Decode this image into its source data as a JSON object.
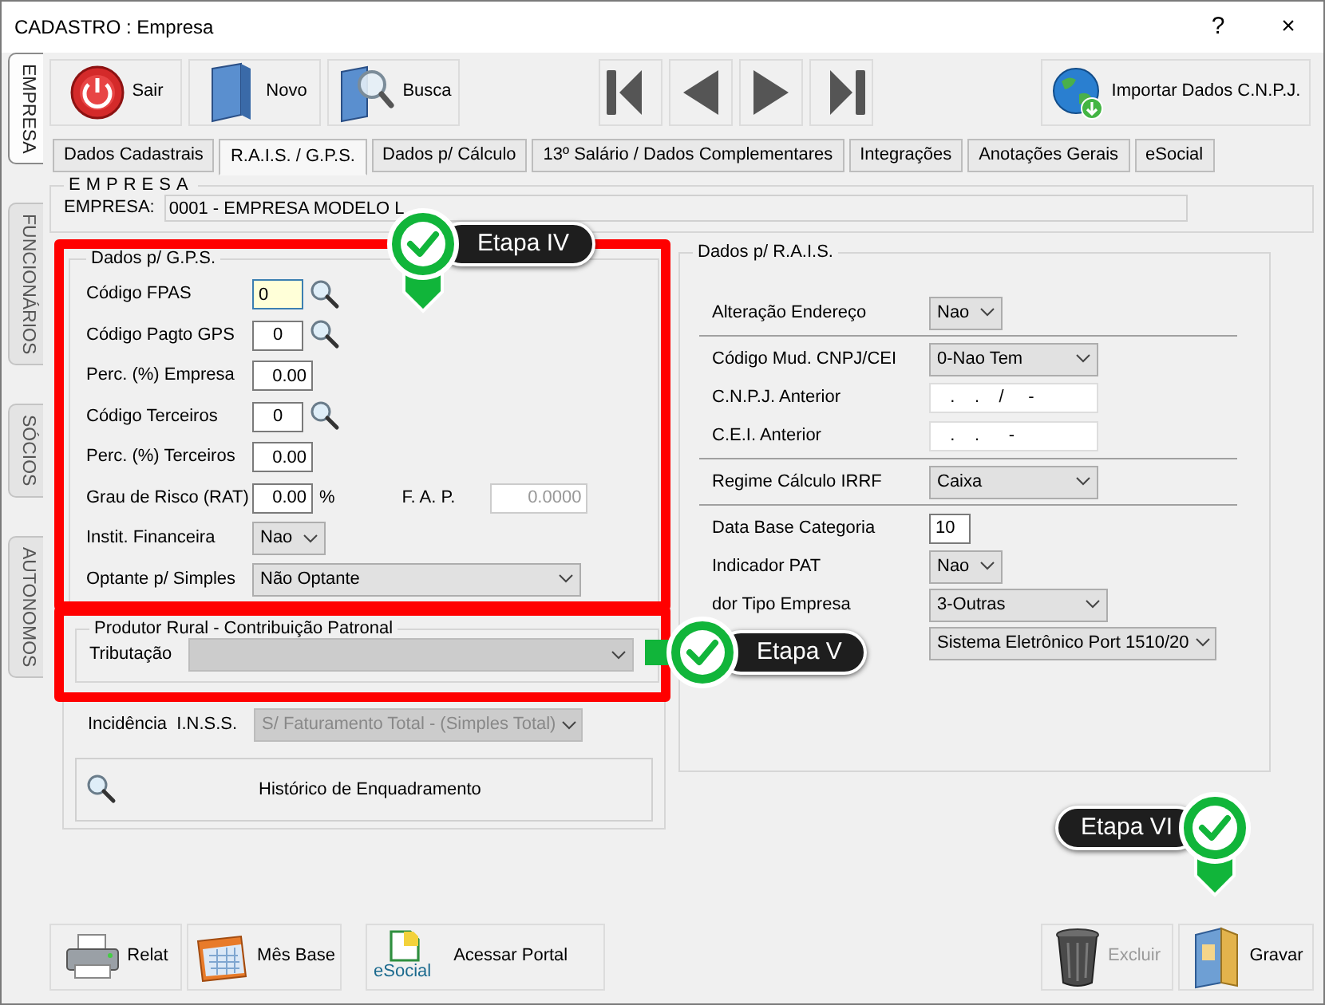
{
  "window": {
    "title": "CADASTRO : Empresa",
    "help": "?",
    "close": "×"
  },
  "side_tabs": [
    {
      "label": "EMPRESA",
      "selected": true
    },
    {
      "label": "FUNCIONÁRIOS",
      "selected": false
    },
    {
      "label": "SÓCIOS",
      "selected": false
    },
    {
      "label": "AUTONOMOS",
      "selected": false
    }
  ],
  "toolbar": [
    {
      "kind": "power",
      "label": "Sair"
    },
    {
      "kind": "book",
      "label": "Novo"
    },
    {
      "kind": "search",
      "label": "Busca"
    }
  ],
  "nav_buttons": [
    {
      "kind": "first"
    },
    {
      "kind": "prev"
    },
    {
      "kind": "next"
    },
    {
      "kind": "last"
    }
  ],
  "import_button": {
    "label": "Importar Dados C.N.P.J."
  },
  "tabs": [
    {
      "label": "Dados Cadastrais",
      "selected": false
    },
    {
      "label": "R.A.I.S. / G.P.S.",
      "selected": true
    },
    {
      "label": "Dados p/ Cálculo",
      "selected": false
    },
    {
      "label": "13º Salário / Dados Complementares",
      "selected": false
    },
    {
      "label": "Integrações",
      "selected": false
    },
    {
      "label": "Anotações Gerais",
      "selected": false
    },
    {
      "label": "eSocial",
      "selected": false
    }
  ],
  "empresa": {
    "legend": "EMPRESA",
    "label": "EMPRESA:",
    "value": "0001 - EMPRESA MODELO L"
  },
  "gps": {
    "legend": "Dados p/ G.P.S.",
    "fields": [
      {
        "kind": "code",
        "label": "Código FPAS",
        "value": "0",
        "lookup": true,
        "focused": true
      },
      {
        "kind": "code",
        "label": "Código Pagto GPS",
        "value": "0",
        "lookup": true,
        "focused": false
      },
      {
        "kind": "number",
        "label": "Perc. (%) Empresa",
        "value": "0.00",
        "lookup": false,
        "focused": false
      },
      {
        "kind": "code",
        "label": "Código Terceiros",
        "value": "0",
        "lookup": true,
        "focused": false
      },
      {
        "kind": "number",
        "label": "Perc. (%) Terceiros",
        "value": "0.00",
        "lookup": false,
        "focused": false
      },
      {
        "kind": "rat",
        "label": "Grau de Risco (RAT)",
        "value": "0.00",
        "suffix": "%",
        "extra_label": "F. A. P.",
        "extra_value": "0.0000",
        "lookup": false,
        "focused": false
      },
      {
        "kind": "small-select",
        "label": "Instit. Financeira",
        "value": "Nao"
      },
      {
        "kind": "wide-select",
        "label": "Optante p/ Simples",
        "value": "Não Optante"
      }
    ]
  },
  "produtor": {
    "legend": "Produtor Rural - Contribuição Patronal",
    "label": "Tributação",
    "disabled": true
  },
  "incidencia": {
    "label": "Incidência  I.N.S.S.",
    "value": "S/ Faturamento Total - (Simples Total)",
    "disabled": true
  },
  "historico_button": {
    "label": "Histórico de Enquadramento"
  },
  "rais": {
    "legend": "Dados p/ R.A.I.S.",
    "sections": [
      [
        {
          "kind": "small-select",
          "label": "Alteração Endereço",
          "value": "Nao"
        }
      ],
      [
        {
          "kind": "select",
          "label": "Código Mud. CNPJ/CEI",
          "value": "0-Nao Tem"
        },
        {
          "kind": "input",
          "label": "C.N.P.J. Anterior",
          "value": "   .    .    /     -"
        },
        {
          "kind": "input",
          "label": "C.E.I. Anterior",
          "value": "   .    .      -"
        }
      ],
      [
        {
          "kind": "select",
          "label": "Regime Cálculo IRRF",
          "value": "Caixa"
        }
      ],
      [
        {
          "kind": "short-input",
          "label": "Data Base Categoria",
          "value": "10"
        },
        {
          "kind": "small-select",
          "label": "Indicador PAT",
          "value": "Nao"
        },
        {
          "kind": "mid-select",
          "label": "dor Tipo Empresa",
          "value": "3-Outras"
        },
        {
          "kind": "long-select",
          "value": "Sistema Eletrônico Port 1510/20"
        }
      ]
    ]
  },
  "bottom_buttons": [
    {
      "kind": "printer",
      "label": "Relat",
      "disabled": false
    },
    {
      "kind": "calendar",
      "label": "Mês Base",
      "disabled": false
    },
    {
      "kind": "esocial",
      "label": "Acessar Portal",
      "logo_text": "eSocial",
      "disabled": false
    },
    {
      "kind": "trash",
      "label": "Excluir",
      "disabled": true
    },
    {
      "kind": "folder",
      "label": "Gravar",
      "disabled": false
    }
  ],
  "annotations": [
    {
      "label": "Etapa IV"
    },
    {
      "label": "Etapa V"
    },
    {
      "label": "Etapa VI"
    }
  ]
}
